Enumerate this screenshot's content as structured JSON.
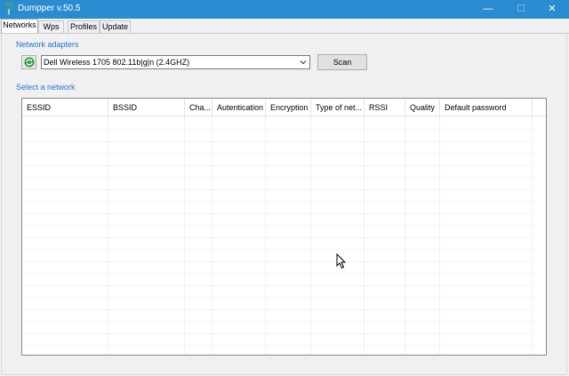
{
  "window": {
    "title": "Dumpper v.50.5",
    "minimize_glyph": "—",
    "maximize_glyph": "☐",
    "close_glyph": "✕"
  },
  "tabs": [
    {
      "label": "Networks",
      "active": true
    },
    {
      "label": "Wps",
      "active": false
    },
    {
      "label": "Profiles",
      "active": false
    },
    {
      "label": "Update",
      "active": false
    }
  ],
  "adapters": {
    "section_label": "Network adapters",
    "selected": "Dell Wireless 1705 802.11b|g|n (2.4GHZ)",
    "refresh_icon": "refresh-icon",
    "scan_label": "Scan"
  },
  "networks": {
    "section_label": "Select a network",
    "columns": [
      "ESSID",
      "BSSID",
      "Cha...",
      "Autentication",
      "Encryption",
      "Type of net...",
      "RSSI",
      "Quality",
      "Default password"
    ],
    "rows": []
  },
  "colors": {
    "titlebar": "#2b8bd0",
    "section_label": "#1f78d1"
  }
}
